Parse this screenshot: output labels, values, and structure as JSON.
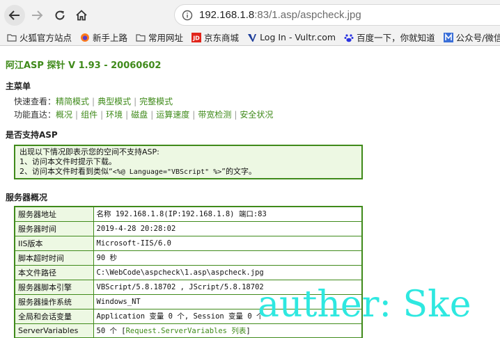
{
  "browser": {
    "url_host": "192.168.1.8",
    "url_rest": ":83/1.asp/aspcheck.jpg",
    "bookmarks": [
      {
        "label": "火狐官方站点",
        "icon": "folder-icon"
      },
      {
        "label": "新手上路",
        "icon": "firefox-icon"
      },
      {
        "label": "常用网址",
        "icon": "folder-icon"
      },
      {
        "label": "京东商城",
        "icon": "jd-icon"
      },
      {
        "label": "Log In - Vultr.com",
        "icon": "vultr-icon"
      },
      {
        "label": "百度一下，你就知道",
        "icon": "baidu-icon"
      },
      {
        "label": "公众号/微信",
        "icon": "m-icon"
      }
    ]
  },
  "page": {
    "title": "阿江ASP 探针 V 1.93 - 20060602",
    "main_menu": {
      "heading": "主菜单",
      "quick_view_label": "快速查看：",
      "quick_view_items": [
        "精简模式",
        "典型模式",
        "完整模式"
      ],
      "nav_label": "功能直达：",
      "nav_items": [
        "概况",
        "组件",
        "环境",
        "磁盘",
        "运算速度",
        "带宽检测",
        "安全状况"
      ]
    },
    "asp_support": {
      "heading": "是否支持ASP",
      "line1": "出现以下情况即表示您的空间不支持ASP:",
      "line2": "1、访问本文件时提示下载。",
      "line3_pre": "2、访问本文件时看到类似“",
      "line3_code": "<%@ Language=\"VBScript\" %>",
      "line3_post": "”的文字。"
    },
    "server_overview": {
      "heading": "服务器概况",
      "rows": [
        {
          "key": "服务器地址",
          "value": "名称 192.168.1.8(IP:192.168.1.8) 端口:83"
        },
        {
          "key": "服务器时间",
          "value": "2019-4-28 20:28:02"
        },
        {
          "key": "IIS版本",
          "value": "Microsoft-IIS/6.0"
        },
        {
          "key": "脚本超时时间",
          "value": "90 秒"
        },
        {
          "key": "本文件路径",
          "value": "C:\\WebCode\\aspcheck\\1.asp\\aspcheck.jpg"
        },
        {
          "key": "服务器脚本引擎",
          "value": "VBScript/5.8.18702 , JScript/5.8.18702"
        },
        {
          "key": "服务器操作系统",
          "value": "Windows_NT"
        },
        {
          "key": "全局和会话变量",
          "value": "Application 变量 0 个, Session 变量 0 个"
        },
        {
          "key": "ServerVariables",
          "value_pre": "50 个 [",
          "value_link": "Request.ServerVariables 列表",
          "value_post": "]"
        }
      ]
    }
  },
  "watermark": "auther: Ske",
  "colors": {
    "accent": "#3f8a1a",
    "cell_bg": "#edf8e3",
    "watermark": "#2ee8e0"
  }
}
